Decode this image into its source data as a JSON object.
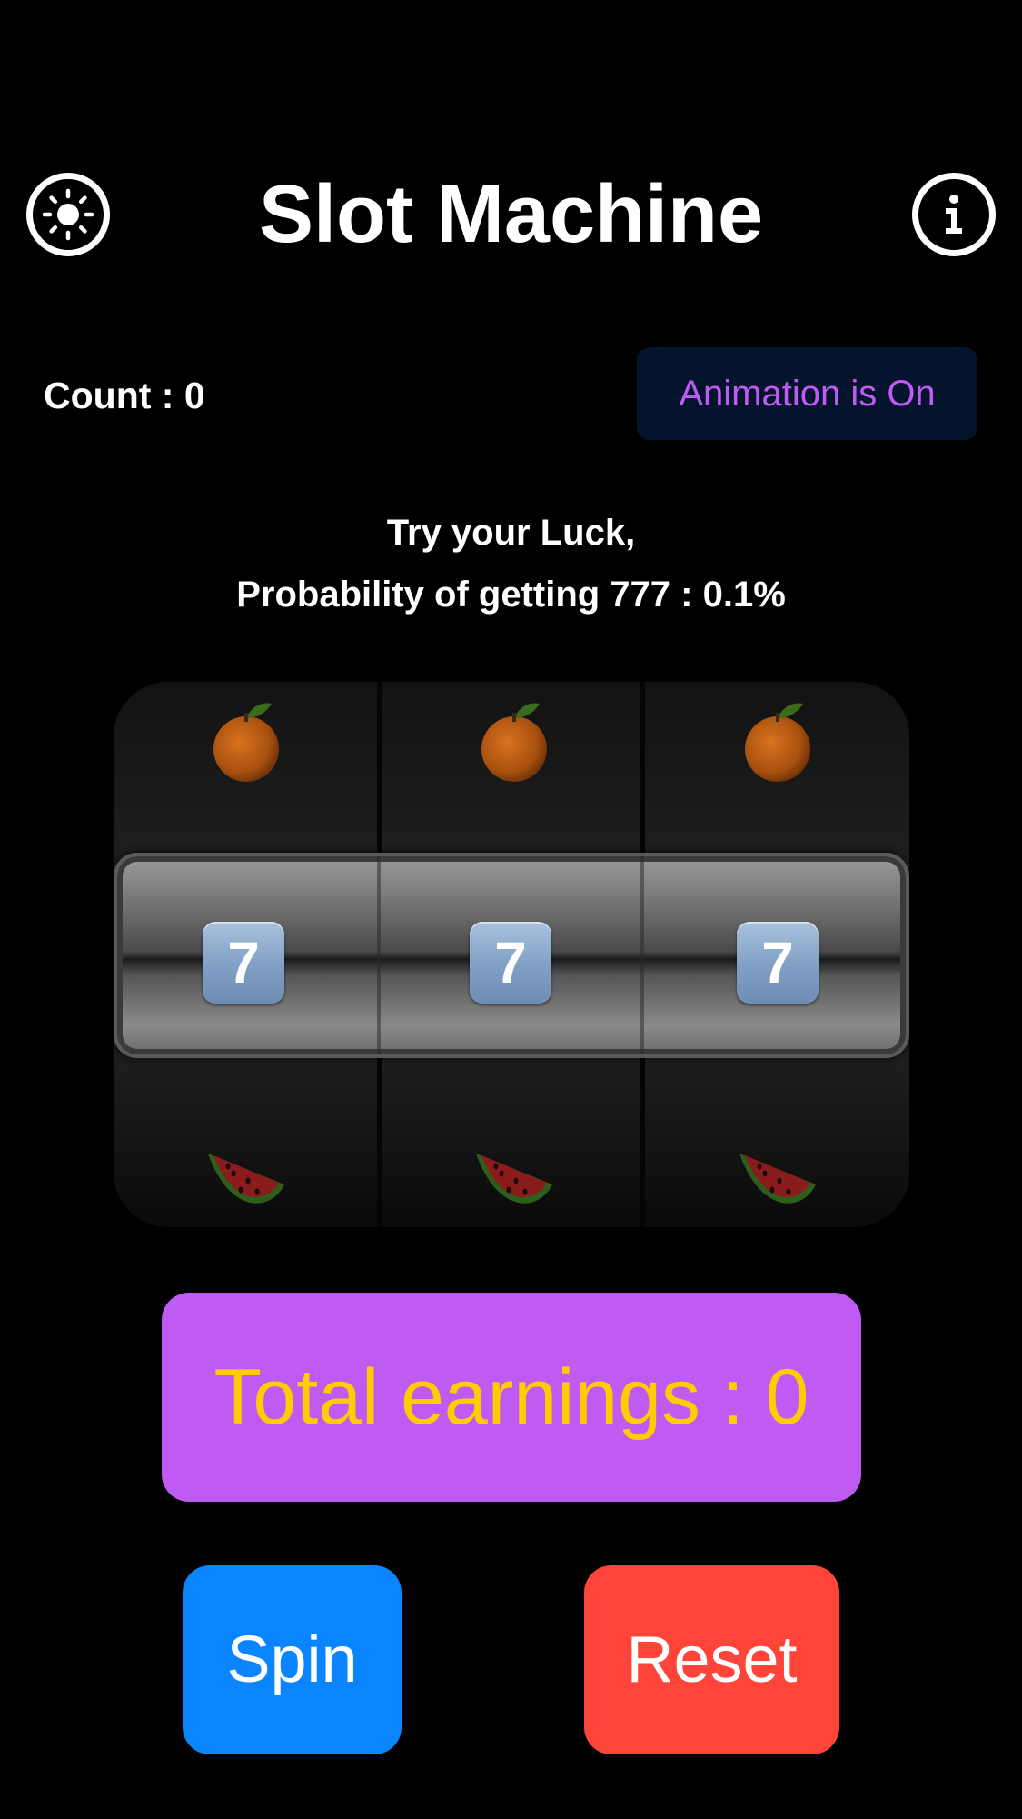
{
  "header": {
    "title": "Slot Machine",
    "left_icon": "sun-icon",
    "right_icon": "info-icon"
  },
  "status": {
    "count_label": "Count : 0",
    "animation_label": "Animation is On"
  },
  "message": {
    "line1": "Try your Luck,",
    "line2": "Probability of getting 777 : 0.1%"
  },
  "reels": [
    {
      "top": "orange",
      "center": "7",
      "bottom": "watermelon"
    },
    {
      "top": "orange",
      "center": "7",
      "bottom": "watermelon"
    },
    {
      "top": "orange",
      "center": "7",
      "bottom": "watermelon"
    }
  ],
  "earnings": {
    "label": "Total earnings : 0"
  },
  "buttons": {
    "spin": "Spin",
    "reset": "Reset"
  },
  "colors": {
    "background": "#000000",
    "earnings_bg": "#bf5af2",
    "earnings_text": "#ffcc00",
    "spin": "#0a84ff",
    "reset": "#ff453a",
    "toggle_bg": "#04142c",
    "toggle_text": "#bf5af2"
  }
}
